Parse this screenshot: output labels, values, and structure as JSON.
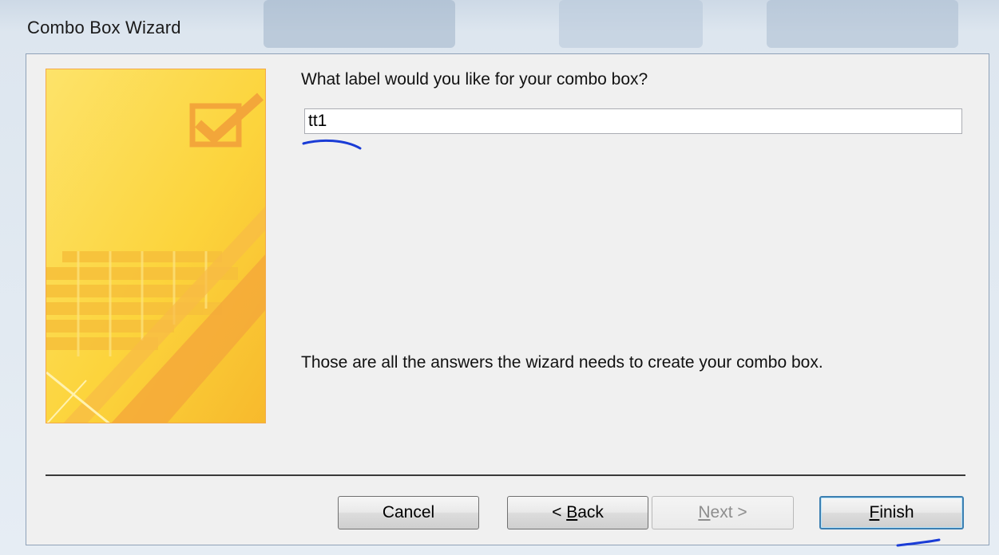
{
  "window": {
    "title": "Combo Box Wizard"
  },
  "wizard": {
    "question": "What label would you like for your combo box?",
    "label_value": "tt1",
    "info": "Those are all the answers the wizard needs to create your combo box."
  },
  "buttons": {
    "cancel": "Cancel",
    "back_prefix": "< ",
    "back_accel": "B",
    "back_rest": "ack",
    "next_accel": "N",
    "next_rest": "ext >",
    "finish_accel": "F",
    "finish_rest": "inish"
  },
  "colors": {
    "banner_yellow": "#fcd744",
    "banner_orange": "#f3a63a",
    "ink_annotation": "#1a3cd6",
    "default_button_border": "#3c7fb1"
  },
  "icons": {
    "banner_checkbox": "checkbox-check-icon"
  }
}
